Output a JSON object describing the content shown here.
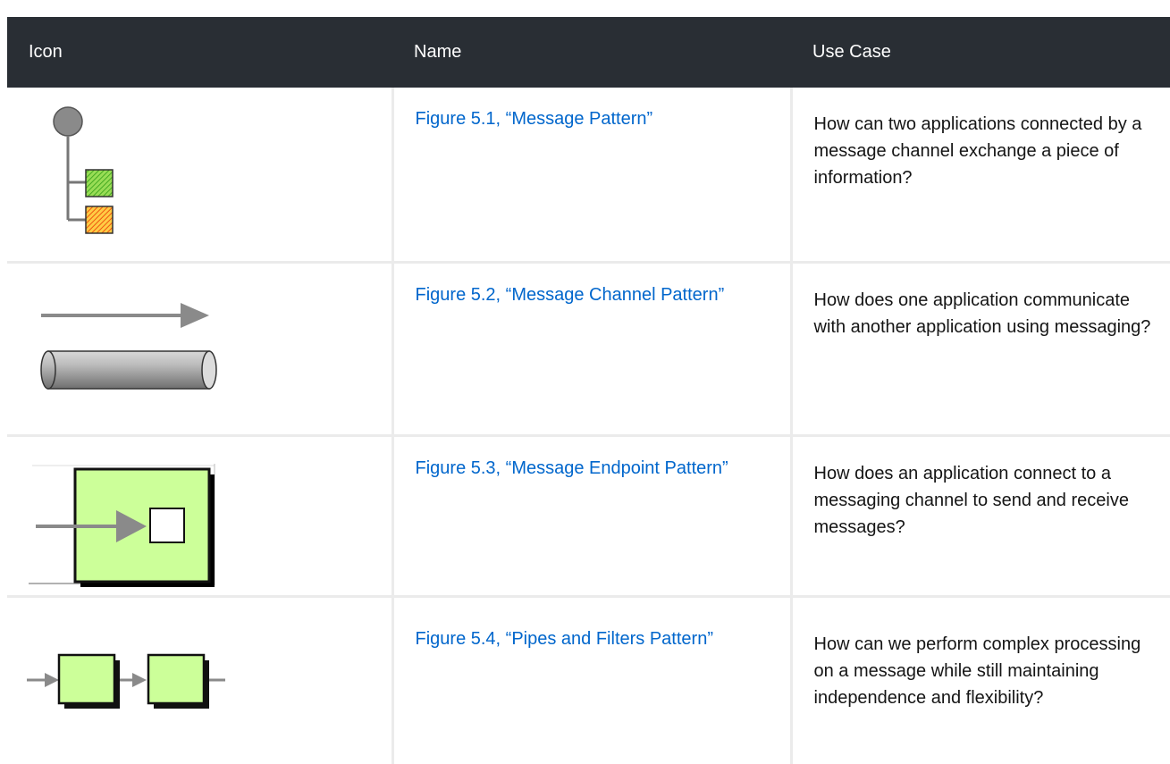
{
  "table": {
    "headers": {
      "icon": "Icon",
      "name": "Name",
      "use_case": "Use Case"
    },
    "rows": [
      {
        "icon": "message-pattern-icon",
        "name": "Figure 5.1, “Message Pattern”",
        "use_case": "How can two applications connected by a message channel exchange a piece of information?"
      },
      {
        "icon": "message-channel-pattern-icon",
        "name": "Figure 5.2, “Message Channel Pattern”",
        "use_case": "How does one application communicate with another application using messaging?"
      },
      {
        "icon": "message-endpoint-pattern-icon",
        "name": "Figure 5.3, “Message Endpoint Pattern”",
        "use_case": "How does an application connect to a messaging channel to send and receive messages?"
      },
      {
        "icon": "pipes-and-filters-pattern-icon",
        "name": "Figure 5.4, “Pipes and Filters Pattern”",
        "use_case": "How can we perform complex processing on a message while still maintaining independence and flexibility?"
      }
    ]
  },
  "colors": {
    "header_background": "#292e34",
    "header_text": "#ffffff",
    "link": "#0066cc",
    "cell_border": "#ebebeb",
    "icon_green": "#ccff99",
    "icon_gray": "#888888"
  }
}
